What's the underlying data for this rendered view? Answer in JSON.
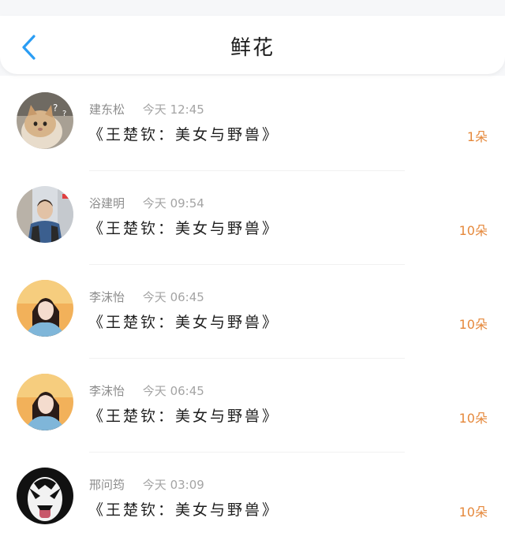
{
  "header": {
    "title": "鲜花",
    "back_icon": "chevron-left-icon",
    "accent_color": "#2a9df4"
  },
  "records": [
    {
      "name": "建东松",
      "time": "今天 12:45",
      "content": "《王楚钦：美女与野兽》",
      "amount": "1朵",
      "avatar": "cat-photo"
    },
    {
      "name": "浴建明",
      "time": "今天 09:54",
      "content": "《王楚钦：美女与野兽》",
      "amount": "10朵",
      "avatar": "man-street-photo"
    },
    {
      "name": "李沫怡",
      "time": "今天 06:45",
      "content": "《王楚钦：美女与野兽》",
      "amount": "10朵",
      "avatar": "woman-photo"
    },
    {
      "name": "李沫怡",
      "time": "今天 06:45",
      "content": "《王楚钦：美女与野兽》",
      "amount": "10朵",
      "avatar": "woman-photo"
    },
    {
      "name": "邢问筠",
      "time": "今天 03:09",
      "content": "《王楚钦：美女与野兽》",
      "amount": "10朵",
      "avatar": "face-paint-photo"
    }
  ],
  "colors": {
    "amount": "#e5883b",
    "meta": "#9a9a9a"
  }
}
